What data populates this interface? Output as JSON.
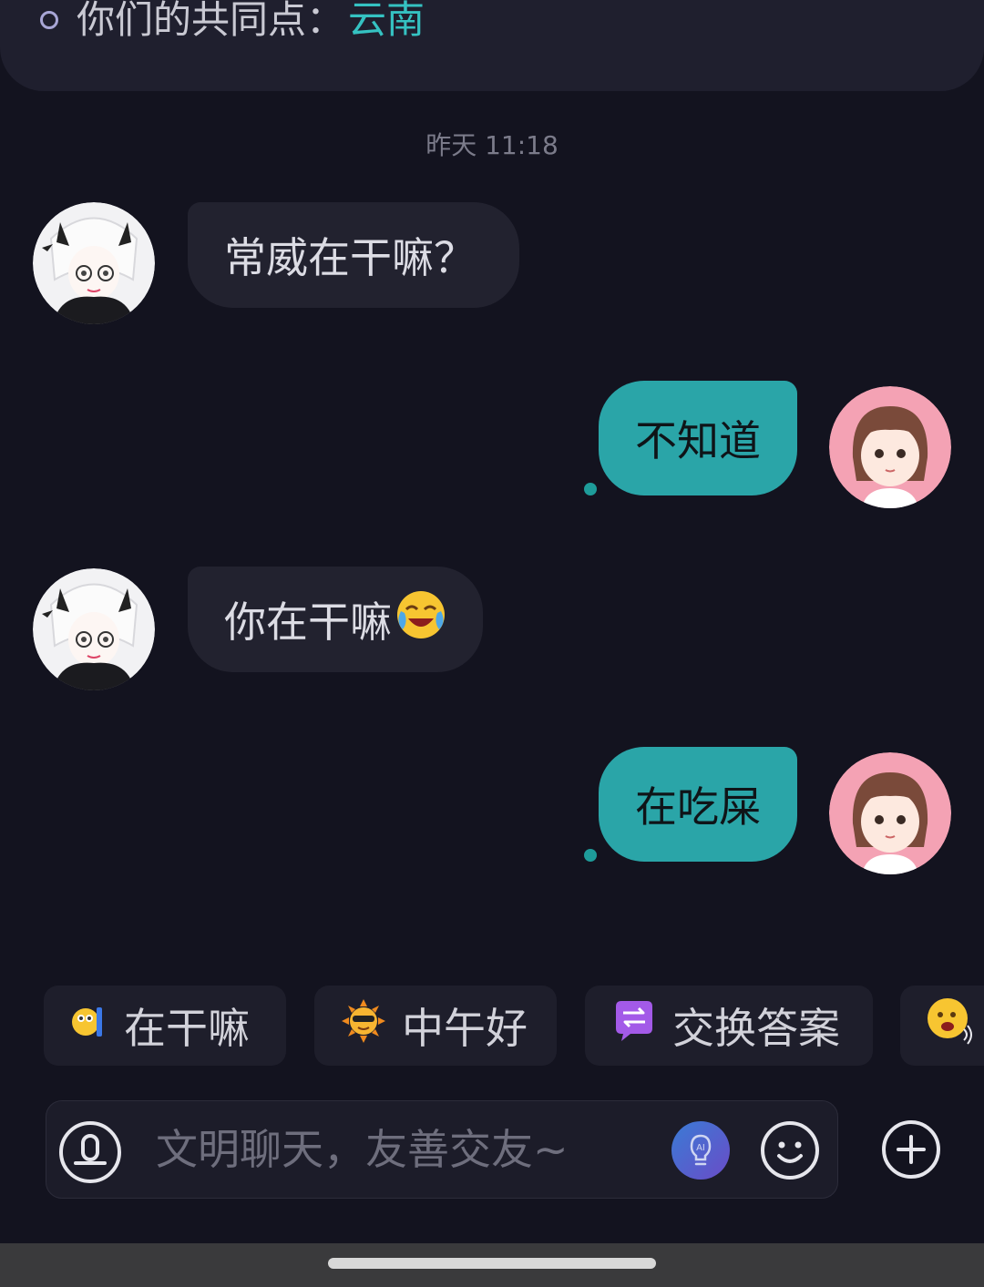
{
  "common_points": {
    "label": "你们的共同点：",
    "value": "云南"
  },
  "timestamp": "昨天 11:18",
  "messages": [
    {
      "side": "in",
      "text": "常威在干嘛？",
      "avatar": "anime-avatar"
    },
    {
      "side": "out",
      "text": "不知道",
      "avatar": "girl-avatar"
    },
    {
      "side": "in",
      "text": "你在干嘛",
      "emoji": "crying-laughing-emoji",
      "avatar": "anime-avatar"
    },
    {
      "side": "out",
      "text": "在吃屎",
      "avatar": "girl-avatar"
    }
  ],
  "quick_replies": [
    {
      "label": "在干嘛",
      "icon": "peeking-emoji-icon"
    },
    {
      "label": "中午好",
      "icon": "sunglasses-sun-icon"
    },
    {
      "label": "交换答案",
      "icon": "exchange-icon"
    },
    {
      "label": "",
      "icon": "talking-emoji-icon"
    }
  ],
  "input": {
    "placeholder": "文明聊天，友善交友~"
  },
  "colors": {
    "accent": "#2aa5a8",
    "common_value": "#35c2c2",
    "background": "#13131f",
    "incoming_bubble": "#22222f"
  }
}
